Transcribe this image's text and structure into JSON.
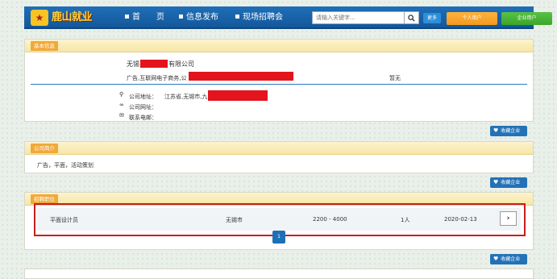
{
  "nav": {
    "logo_text": "鹿山就业",
    "items": [
      {
        "label": "首　　页"
      },
      {
        "label": "信息发布"
      },
      {
        "label": "现场招聘会"
      }
    ],
    "search_placeholder": "请输入关键字...",
    "more_label": "更多",
    "personal_label": "个人用户",
    "company_label": "企业用户"
  },
  "basic": {
    "section_title": "基本信息",
    "company_name_prefix": "无锡",
    "company_name_suffix": "有限公司",
    "industry_prefix": "广告,互联网电子商务,公",
    "na_text": "暂无",
    "address_label": "公司地址：",
    "address_value": "江苏省,无锡市,九",
    "website_label": "公司网址：",
    "phone_label": "联系电邮：",
    "fav_label": "收藏企业"
  },
  "intro": {
    "section_title": "公司简介",
    "text": "广告，平面，活动策划",
    "fav_label": "收藏企业"
  },
  "jobs": {
    "section_title": "招聘职位",
    "rows": [
      {
        "title": "平面设计员",
        "city": "无锡市",
        "salary": "2200 - 4000",
        "count": "1人",
        "date": "2020-02-13"
      }
    ],
    "arrow_label": "›",
    "page_label": "1",
    "fav_label": "收藏企业"
  },
  "colors": {
    "nav_blue": "#1f6fb8",
    "redaction": "#e3141b",
    "highlight": "#c81e1e",
    "tag_orange": "#f0a93a"
  }
}
